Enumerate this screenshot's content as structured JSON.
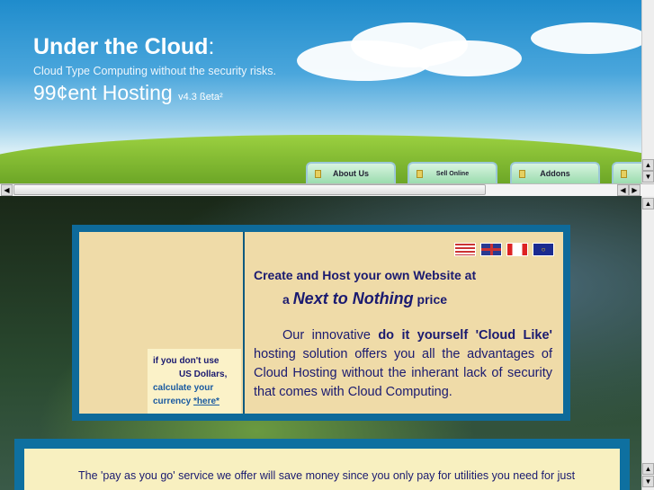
{
  "header": {
    "title": "Under the Cloud",
    "title_colon": ":",
    "subtitle": "Cloud Type Computing without the security risks.",
    "hosting": "99¢ent Hosting",
    "version": "v4.3 ßeta²"
  },
  "tabs": [
    {
      "label": "About Us"
    },
    {
      "label": "Sell Online"
    },
    {
      "label": "Addons"
    },
    {
      "label": ""
    }
  ],
  "currency": {
    "line1": "if you don't use",
    "line2": "US Dollars,",
    "line3": "calculate your",
    "line4": "currency ",
    "link": "*here*"
  },
  "flags": [
    "us-flag",
    "uk-flag",
    "canada-flag",
    "eu-flag"
  ],
  "main": {
    "heading": "Create and Host your own Website at",
    "np_a": "a ",
    "np_em": "Next to Nothing",
    "np_price": " price",
    "para_start": "Our innovative ",
    "para_bold": "do it yourself 'Cloud Like'",
    "para_rest": " hosting solution offers you all the advantages of Cloud Hosting without the inherant lack of security that comes with Cloud Computing."
  },
  "bottom": {
    "text": "The 'pay as you go' service we offer will save money since you only pay for utilities you need for just"
  }
}
